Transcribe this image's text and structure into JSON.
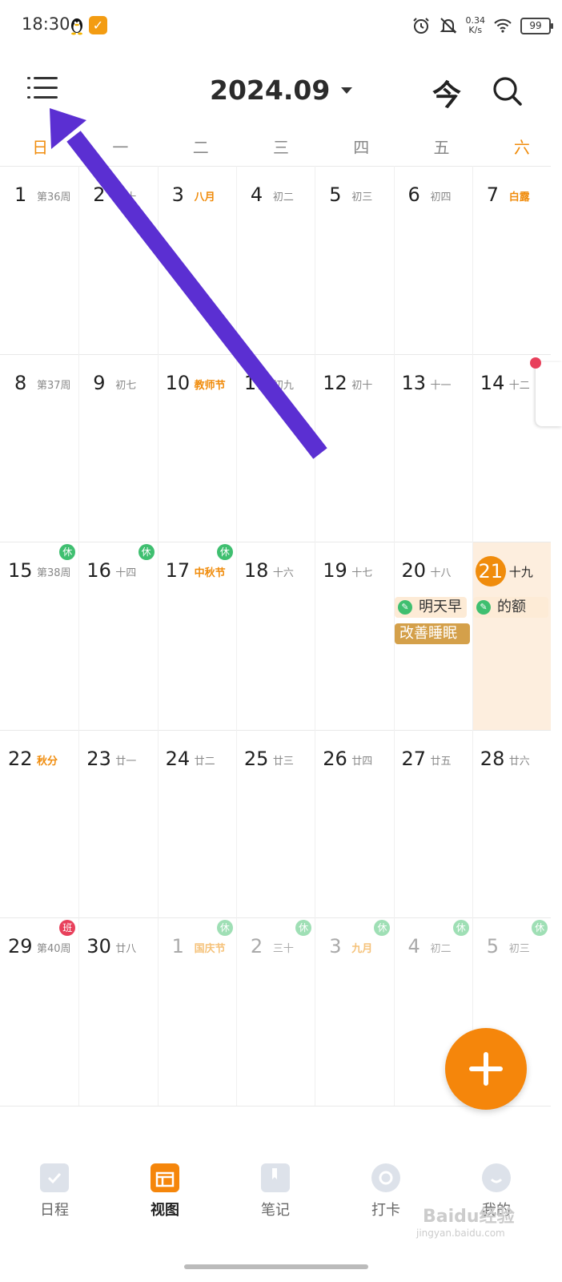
{
  "status_bar": {
    "time": "18:30",
    "speed_value": "0.34",
    "speed_unit": "K/s",
    "battery": "99"
  },
  "header": {
    "title": "2024.09",
    "today_label": "今"
  },
  "weekdays": [
    "日",
    "一",
    "二",
    "三",
    "四",
    "五",
    "六"
  ],
  "calendar": {
    "weeks": [
      [
        {
          "day": "1",
          "lunar": "第36周"
        },
        {
          "day": "2",
          "lunar": "三十"
        },
        {
          "day": "3",
          "lunar": "八月",
          "holiday": true
        },
        {
          "day": "4",
          "lunar": "初二"
        },
        {
          "day": "5",
          "lunar": "初三"
        },
        {
          "day": "6",
          "lunar": "初四"
        },
        {
          "day": "7",
          "lunar": "白露",
          "holiday": true
        }
      ],
      [
        {
          "day": "8",
          "lunar": "第37周"
        },
        {
          "day": "9",
          "lunar": "初七"
        },
        {
          "day": "10",
          "lunar": "教师节",
          "holiday": true
        },
        {
          "day": "11",
          "lunar": "初九"
        },
        {
          "day": "12",
          "lunar": "初十"
        },
        {
          "day": "13",
          "lunar": "十一"
        },
        {
          "day": "14",
          "lunar": "十二"
        }
      ],
      [
        {
          "day": "15",
          "lunar": "第38周",
          "badge": "休"
        },
        {
          "day": "16",
          "lunar": "十四",
          "badge": "休"
        },
        {
          "day": "17",
          "lunar": "中秋节",
          "holiday": true,
          "badge": "休"
        },
        {
          "day": "18",
          "lunar": "十六"
        },
        {
          "day": "19",
          "lunar": "十七"
        },
        {
          "day": "20",
          "lunar": "十八"
        },
        {
          "day": "21",
          "lunar": "十九",
          "today": true
        }
      ],
      [
        {
          "day": "22",
          "lunar": "秋分",
          "holiday": true
        },
        {
          "day": "23",
          "lunar": "廿一"
        },
        {
          "day": "24",
          "lunar": "廿二"
        },
        {
          "day": "25",
          "lunar": "廿三"
        },
        {
          "day": "26",
          "lunar": "廿四"
        },
        {
          "day": "27",
          "lunar": "廿五"
        },
        {
          "day": "28",
          "lunar": "廿六"
        }
      ],
      [
        {
          "day": "29",
          "lunar": "第40周",
          "badge": "班"
        },
        {
          "day": "30",
          "lunar": "廿八"
        },
        {
          "day": "1",
          "lunar": "国庆节",
          "holiday": true,
          "other": true,
          "badge": "休"
        },
        {
          "day": "2",
          "lunar": "三十",
          "other": true,
          "badge": "休"
        },
        {
          "day": "3",
          "lunar": "九月",
          "holiday": true,
          "other": true,
          "badge": "休"
        },
        {
          "day": "4",
          "lunar": "初二",
          "other": true,
          "badge": "休"
        },
        {
          "day": "5",
          "lunar": "初三",
          "other": true,
          "badge": "休"
        }
      ]
    ],
    "events": {
      "ev1": "明天早",
      "ev2": "改善睡眠",
      "ev3": "的额"
    }
  },
  "bottom_nav": [
    {
      "label": "日程",
      "icon": "check-icon"
    },
    {
      "label": "视图",
      "icon": "calendar-view-icon",
      "active": true
    },
    {
      "label": "笔记",
      "icon": "notebook-icon"
    },
    {
      "label": "打卡",
      "icon": "target-icon"
    },
    {
      "label": "我的",
      "icon": "profile-icon"
    }
  ],
  "watermark": {
    "text": "Baidu经验",
    "sub": "jingyan.baidu.com"
  },
  "colors": {
    "accent": "#f08c0c",
    "rest_badge": "#3fbf70",
    "work_badge": "#e8405b",
    "today_highlight": "#fdeede",
    "arrow": "#5b2fd2"
  }
}
